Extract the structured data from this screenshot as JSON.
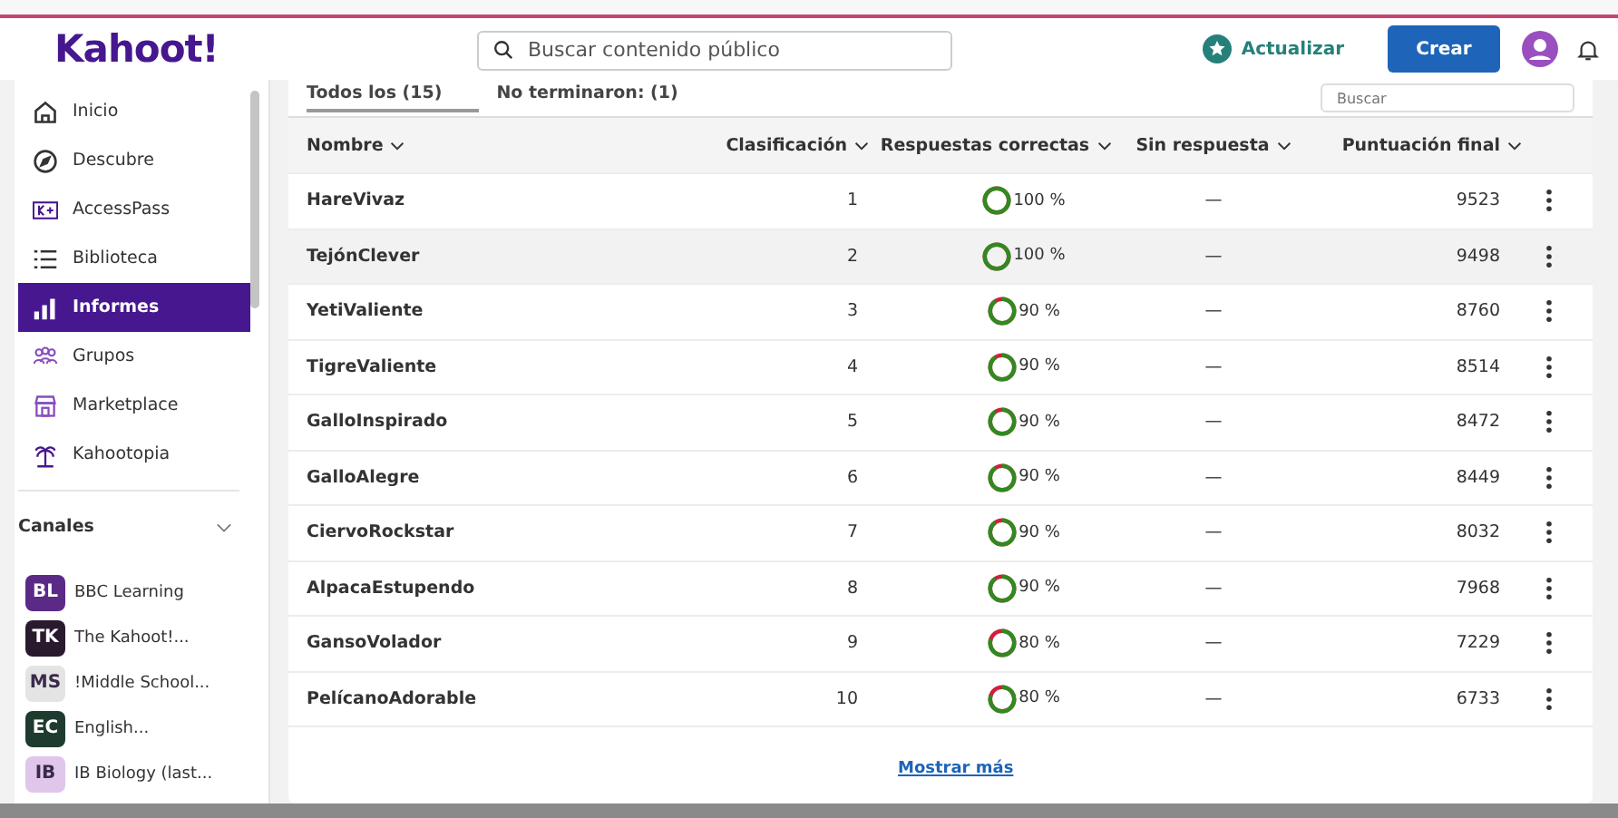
{
  "header": {
    "logo": "Kahoot!",
    "search": {
      "placeholder": "Buscar contenido público"
    },
    "upgrade": "Actualizar",
    "create": "Crear"
  },
  "sidebar": {
    "items": [
      {
        "label": "Inicio",
        "selected": false
      },
      {
        "label": "Descubre",
        "selected": false
      },
      {
        "label": "AccessPass",
        "selected": false
      },
      {
        "label": "Biblioteca",
        "selected": false
      },
      {
        "label": "Informes",
        "selected": true
      },
      {
        "label": "Grupos",
        "selected": false
      },
      {
        "label": "Marketplace",
        "selected": false
      },
      {
        "label": "Kahootopia",
        "selected": false
      }
    ],
    "channels_title": "Canales",
    "channels_expanded": true,
    "channels": [
      {
        "initials": "BL",
        "name": "BBC Learning",
        "color": "#5b2a86"
      },
      {
        "initials": "TK",
        "name": "The Kahoot!...",
        "color": "#2a1a2e"
      },
      {
        "initials": "MS",
        "name": "!Middle School...",
        "color": "#e4e4e4"
      },
      {
        "initials": "EC",
        "name": "English...",
        "color": "#1f3b2f"
      },
      {
        "initials": "IB",
        "name": "IB Biology (last...",
        "color": "#dfc6ea"
      }
    ]
  },
  "tabs": [
    {
      "label": "Todos los (15)",
      "selected": true
    },
    {
      "label": "No terminaron: (1)",
      "selected": false
    }
  ],
  "filter": {
    "placeholder": "Buscar"
  },
  "table": {
    "columns": [
      "Nombre",
      "Clasificación",
      "Respuestas correctas",
      "Sin respuesta",
      "Puntuación final"
    ],
    "rows": [
      {
        "name": "HareVivaz",
        "rank": "1",
        "kind": "full",
        "correct": "100 %",
        "unanswered": "—",
        "score": "9523",
        "selected": false
      },
      {
        "name": "TejónClever",
        "rank": "2",
        "kind": "full",
        "correct": "100 %",
        "unanswered": "—",
        "score": "9498",
        "selected": true
      },
      {
        "name": "YetiValiente",
        "rank": "3",
        "kind": "ninety",
        "correct": "90 %",
        "unanswered": "—",
        "score": "8760",
        "selected": false
      },
      {
        "name": "TigreValiente",
        "rank": "4",
        "kind": "ninety",
        "correct": "90 %",
        "unanswered": "—",
        "score": "8514",
        "selected": false
      },
      {
        "name": "GalloInspirado",
        "rank": "5",
        "kind": "ninety",
        "correct": "90 %",
        "unanswered": "—",
        "score": "8472",
        "selected": false
      },
      {
        "name": "GalloAlegre",
        "rank": "6",
        "kind": "ninety",
        "correct": "90 %",
        "unanswered": "—",
        "score": "8449",
        "selected": false
      },
      {
        "name": "CiervoRockstar",
        "rank": "7",
        "kind": "ninety",
        "correct": "90 %",
        "unanswered": "—",
        "score": "8032",
        "selected": false
      },
      {
        "name": "AlpacaEstupendo",
        "rank": "8",
        "kind": "ninety",
        "correct": "90 %",
        "unanswered": "—",
        "score": "7968",
        "selected": false
      },
      {
        "name": "GansoVolador",
        "rank": "9",
        "kind": "eighty",
        "correct": "80 %",
        "unanswered": "—",
        "score": "7229",
        "selected": false
      },
      {
        "name": "PelícanoAdorable",
        "rank": "10",
        "kind": "eighty",
        "correct": "80 %",
        "unanswered": "—",
        "score": "6733",
        "selected": false
      }
    ]
  },
  "show_more": "Mostrar más"
}
